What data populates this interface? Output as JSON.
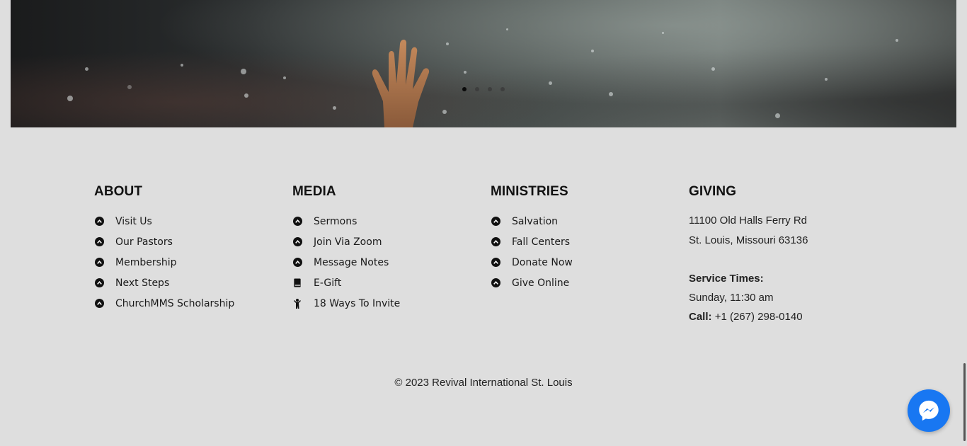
{
  "slider": {
    "dots": [
      {
        "active": true
      },
      {
        "active": false
      },
      {
        "active": false
      },
      {
        "active": false
      }
    ]
  },
  "footer": {
    "about": {
      "heading": "ABOUT",
      "items": [
        "Visit Us",
        "Our Pastors",
        "Membership",
        "Next Steps",
        "ChurchMMS Scholarship"
      ]
    },
    "media": {
      "heading": "MEDIA",
      "items": [
        "Sermons",
        "Join Via Zoom",
        "Message Notes",
        "E-Gift",
        "18 Ways To Invite"
      ]
    },
    "ministries": {
      "heading": "MINISTRIES",
      "items": [
        "Salvation",
        "Fall Centers",
        "Donate Now",
        "Give Online"
      ]
    },
    "giving": {
      "heading": "GIVING",
      "address_line1": "11100 Old Halls Ferry Rd",
      "address_line2": "St. Louis, Missouri 63136",
      "service_label": "Service Times:",
      "service_time": "Sunday, 11:30 am",
      "call_label": "Call:",
      "phone": "+1 (267) 298-0140"
    },
    "copyright": "© 2023 Revival International St. Louis"
  },
  "icons": {
    "list_bullet": "circle-chevron-up-icon",
    "egift": "book-icon",
    "invite": "person-icon",
    "chat": "messenger-icon"
  },
  "colors": {
    "footer_bg": "#dedede",
    "messenger": "#1877f2"
  }
}
